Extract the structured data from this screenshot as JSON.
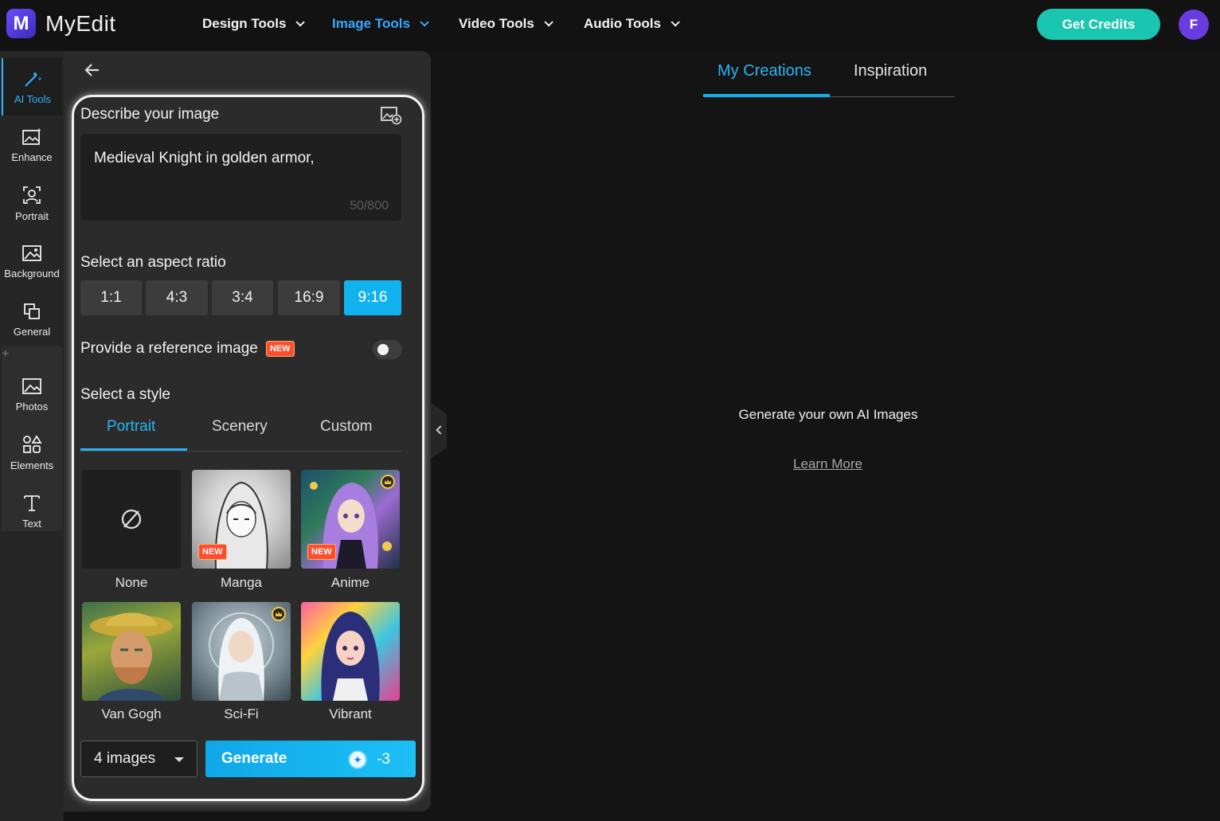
{
  "header": {
    "logo_text": "MyEdit",
    "nav": [
      {
        "label": "Design Tools"
      },
      {
        "label": "Image Tools"
      },
      {
        "label": "Video Tools"
      },
      {
        "label": "Audio Tools"
      }
    ],
    "get_credits": "Get Credits",
    "avatar_initial": "F"
  },
  "rail": {
    "items": [
      {
        "label": "AI Tools",
        "icon": "magic-wand-icon"
      },
      {
        "label": "Enhance",
        "icon": "enhance-icon"
      },
      {
        "label": "Portrait",
        "icon": "portrait-icon"
      },
      {
        "label": "Background",
        "icon": "background-icon"
      },
      {
        "label": "General",
        "icon": "general-icon"
      },
      {
        "label": "Photos",
        "icon": "photos-icon"
      },
      {
        "label": "Elements",
        "icon": "elements-icon"
      },
      {
        "label": "Text",
        "icon": "text-icon"
      }
    ],
    "plus": "+"
  },
  "panel": {
    "describe_label": "Describe your image",
    "prompt_text": "Medieval Knight in golden armor,",
    "prompt_count": "50/800",
    "aspect_label": "Select an aspect ratio",
    "ratios": [
      "1:1",
      "4:3",
      "3:4",
      "16:9",
      "9:16"
    ],
    "selected_ratio": "9:16",
    "reference_label": "Provide a reference image",
    "new_badge": "NEW",
    "style_label": "Select a style",
    "style_tabs": [
      "Portrait",
      "Scenery",
      "Custom"
    ],
    "styles": [
      {
        "name": "None"
      },
      {
        "name": "Manga"
      },
      {
        "name": "Anime"
      },
      {
        "name": "Van Gogh"
      },
      {
        "name": "Sci-Fi"
      },
      {
        "name": "Vibrant"
      }
    ],
    "image_count": "4 images",
    "generate_label": "Generate",
    "generate_cost": "-3"
  },
  "main": {
    "tabs": [
      "My Creations",
      "Inspiration"
    ],
    "empty_title": "Generate your own AI Images",
    "learn_more": "Learn More"
  },
  "colors": {
    "accent": "#12b2ee",
    "credits_button": "#1ac6b0",
    "avatar": "#6a3ce0",
    "new_badge": "#ff4d2e"
  }
}
